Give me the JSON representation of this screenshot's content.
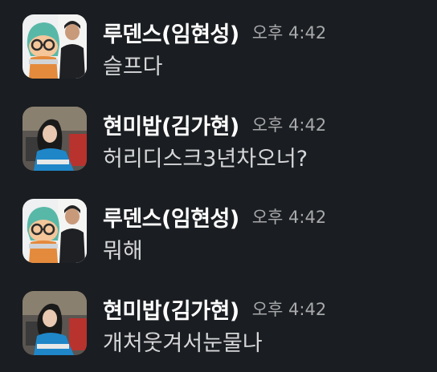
{
  "messages": [
    {
      "sender": "루덴스(임현성)",
      "time": "오후 4:42",
      "text": "슬프다",
      "avatar": "ludens-avatar"
    },
    {
      "sender": "현미밥(김가현)",
      "time": "오후 4:42",
      "text": "허리디스크3년차오너?",
      "avatar": "hyeonmibap-avatar"
    },
    {
      "sender": "루덴스(임현성)",
      "time": "오후 4:42",
      "text": "뭐해",
      "avatar": "ludens-avatar"
    },
    {
      "sender": "현미밥(김가현)",
      "time": "오후 4:42",
      "text": "개처웃겨서눈물나",
      "avatar": "hyeonmibap-avatar"
    }
  ],
  "colors": {
    "background": "#1a1d21",
    "sender": "#ffffff",
    "time": "#a8a9ab",
    "text": "#d6d7d9"
  }
}
